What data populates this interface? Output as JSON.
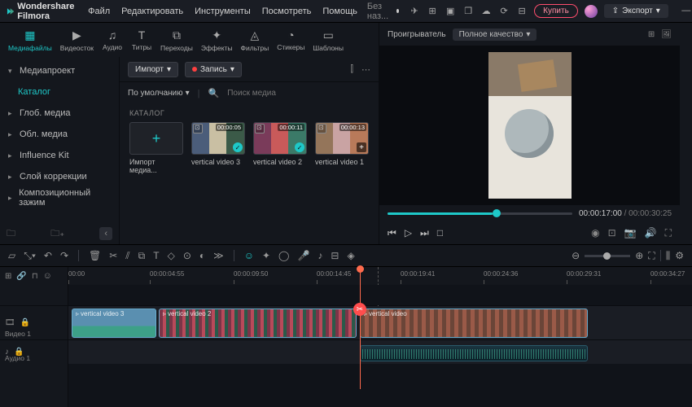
{
  "app": {
    "name": "Wondershare Filmora",
    "unsaved": "Без наз..."
  },
  "menu": [
    "Файл",
    "Редактировать",
    "Инструменты",
    "Посмотреть",
    "Помощь"
  ],
  "titlebar": {
    "buy": "Купить",
    "export": "Экспорт"
  },
  "tool_tabs": [
    {
      "label": "Медиафайлы",
      "active": true
    },
    {
      "label": "Видеосток"
    },
    {
      "label": "Аудио"
    },
    {
      "label": "Титры"
    },
    {
      "label": "Переходы"
    },
    {
      "label": "Эффекты"
    },
    {
      "label": "Фильтры"
    },
    {
      "label": "Стикеры"
    },
    {
      "label": "Шаблоны"
    }
  ],
  "sidebar": {
    "items": [
      {
        "label": "Медиапроект",
        "expand": "▾"
      },
      {
        "label": "Каталог",
        "sub": true
      },
      {
        "label": "Глоб. медиа",
        "expand": "▸"
      },
      {
        "label": "Обл. медиа",
        "expand": "▸"
      },
      {
        "label": "Influence Kit",
        "expand": "▸"
      },
      {
        "label": "Слой коррекции",
        "expand": "▸"
      },
      {
        "label": "Композиционный зажим",
        "expand": "▸"
      }
    ]
  },
  "mid": {
    "import_btn": "Импорт",
    "record_btn": "Запись",
    "sort": "По умолчанию",
    "search_placeholder": "Поиск медиа",
    "catalog_label": "КАТАЛОГ",
    "thumbs": [
      {
        "label": "Импорт медиа...",
        "import": true
      },
      {
        "label": "vertical video 3",
        "dur": "00:00:05",
        "check": true
      },
      {
        "label": "vertical video 2",
        "dur": "00:00:11",
        "check": true
      },
      {
        "label": "vertical video 1",
        "dur": "00:00:13",
        "add": true
      }
    ]
  },
  "player": {
    "header": "Проигрыватель",
    "quality": "Полное качество",
    "cur": "00:00:17:00",
    "tot": "00:00:30:25"
  },
  "timeline": {
    "ticks": [
      "00:00",
      "00:00:04:55",
      "00:00:09:50",
      "00:00:14:45",
      "00:00:19:41",
      "00:00:24:36",
      "00:00:29:31",
      "00:00:34:27"
    ],
    "video_label": "Видео 1",
    "audio_label": "Аудио 1",
    "clips": [
      {
        "title": "vertical video 3"
      },
      {
        "title": "vertical video 2"
      },
      {
        "title": "vertical video"
      }
    ]
  }
}
